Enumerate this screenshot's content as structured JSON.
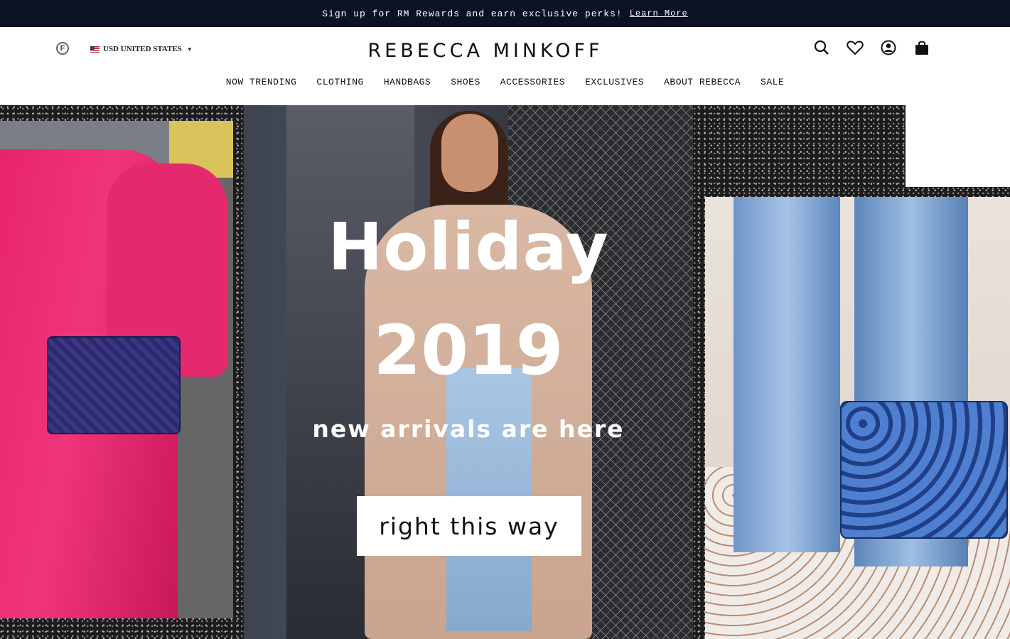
{
  "promo": {
    "text": "Sign up for RM Rewards and earn exclusive perks!",
    "link": "Learn More"
  },
  "header": {
    "badge": "F",
    "currency": "USD UNITED STATES",
    "logo": "REBECCA MINKOFF"
  },
  "nav": {
    "items": [
      "NOW TRENDING",
      "CLOTHING",
      "HANDBAGS",
      "SHOES",
      "ACCESSORIES",
      "EXCLUSIVES",
      "ABOUT REBECCA",
      "SALE"
    ]
  },
  "icons": [
    "search-icon",
    "heart-icon",
    "account-icon",
    "bag-icon"
  ],
  "hero": {
    "title": "Holiday",
    "year": "2019",
    "subtitle": "new arrivals are here",
    "cta": "right this way"
  },
  "colors": {
    "promo_bg": "#0b1224",
    "coat_pink": "#e8246b"
  }
}
